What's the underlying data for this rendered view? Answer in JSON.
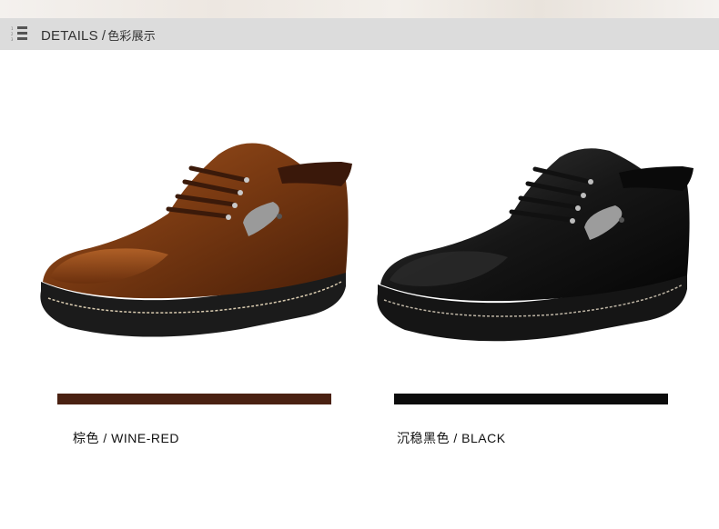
{
  "header": {
    "menu_numbers": [
      "1",
      "2",
      "3"
    ],
    "title_en": "DETAILS",
    "separator": "/",
    "title_zh": "色彩展示"
  },
  "colors": [
    {
      "label": "棕色 / WINE-RED",
      "swatch": "#4a2112"
    },
    {
      "label": "沉稳黑色 / BLACK",
      "swatch": "#0c0c0c"
    }
  ]
}
